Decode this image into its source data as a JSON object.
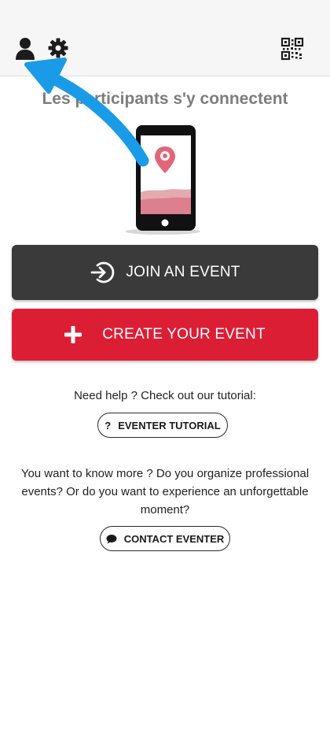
{
  "topbar": {
    "profile_icon": "person-icon",
    "settings_icon": "gear-icon",
    "qr_icon": "qr-code-icon"
  },
  "hero": {
    "subtitle": "Les participants s'y connectent",
    "illustration": "phone-with-location-pin"
  },
  "actions": {
    "join_label": "JOIN AN EVENT",
    "join_icon": "sign-in-icon",
    "create_label": "CREATE YOUR EVENT",
    "create_icon": "plus-icon"
  },
  "help": {
    "text": "Need help ? Check out our tutorial:",
    "tutorial_icon": "question-mark",
    "tutorial_label": "EVENTER TUTORIAL",
    "tutorial_glyph": "?"
  },
  "more": {
    "text": "You want to know more ? Do you organize professional events? Or do you want to experience an unforgettable moment?",
    "contact_icon": "chat-bubble-icon",
    "contact_label": "CONTACT EVENTER"
  },
  "colors": {
    "join_bg": "#3a3a3a",
    "create_bg": "#dc1e35",
    "annotation_arrow": "#1a9be8",
    "brand_pink": "#e2667a"
  }
}
